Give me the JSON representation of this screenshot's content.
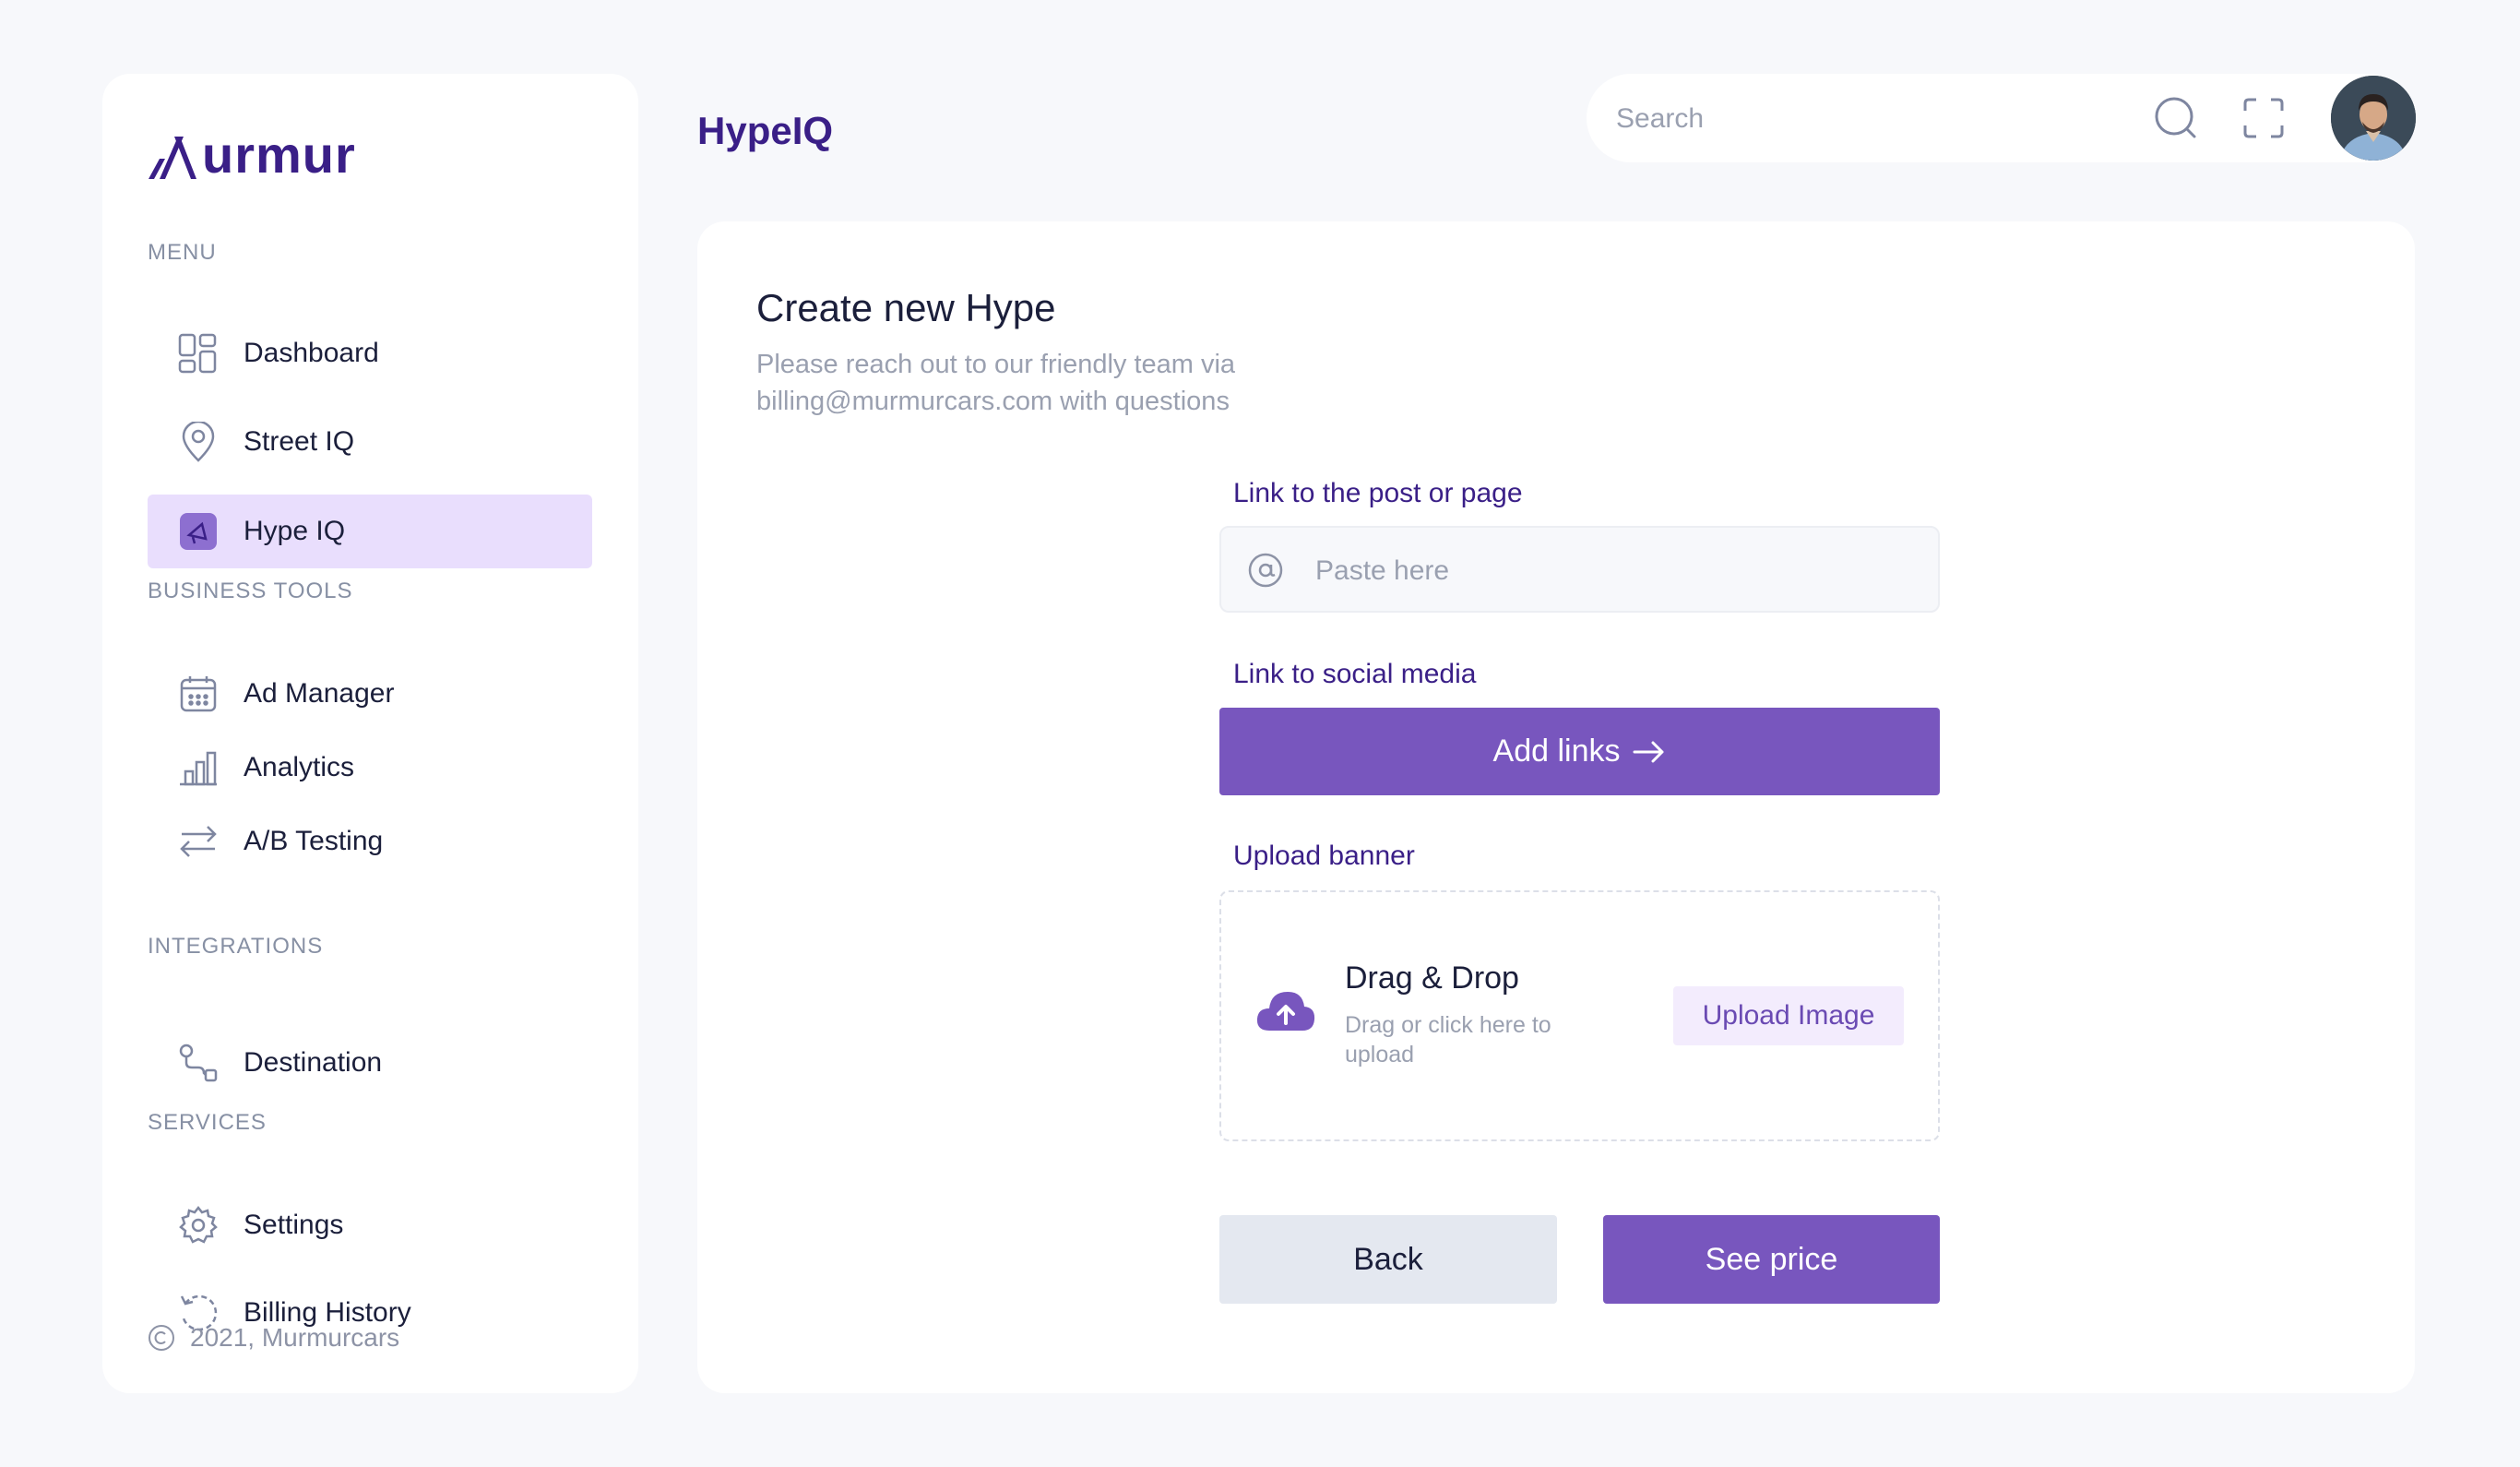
{
  "app": {
    "logo_text": "urmur",
    "page_title": "HypeIQ"
  },
  "sidebar": {
    "sections": [
      {
        "label": "MENU"
      },
      {
        "label": "BUSINESS TOOLS"
      },
      {
        "label": "INTEGRATIONS"
      },
      {
        "label": "SERVICES"
      }
    ],
    "items": [
      {
        "label": "Dashboard",
        "icon": "grid-icon"
      },
      {
        "label": "Street IQ",
        "icon": "location-pin-icon"
      },
      {
        "label": "Hype IQ",
        "icon": "megaphone-icon",
        "active": true
      },
      {
        "label": "Ad Manager",
        "icon": "calendar-icon"
      },
      {
        "label": "Analytics",
        "icon": "bar-chart-icon"
      },
      {
        "label": "A/B Testing",
        "icon": "swap-arrows-icon"
      },
      {
        "label": "Destination",
        "icon": "route-icon"
      },
      {
        "label": "Settings",
        "icon": "gear-icon"
      },
      {
        "label": "Billing History",
        "icon": "history-icon"
      }
    ],
    "copyright": "2021, Murmurcars"
  },
  "topbar": {
    "search_placeholder": "Search"
  },
  "form": {
    "title": "Create new Hype",
    "subtitle": "Please reach out to our friendly team via billing@murmurcars.com with questions",
    "link_label": "Link to the post or page",
    "link_placeholder": "Paste here",
    "social_label": "Link to social media",
    "add_links_label": "Add links",
    "banner_label": "Upload banner",
    "drag_title": "Drag & Drop",
    "drag_sub": "Drag or click here to upload",
    "upload_button": "Upload Image",
    "back_button": "Back",
    "price_button": "See price"
  },
  "colors": {
    "brand": "#3a1f87",
    "accent": "#7856be",
    "active_bg": "#e9defd"
  }
}
